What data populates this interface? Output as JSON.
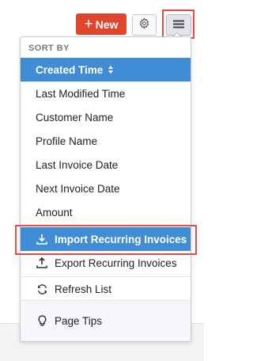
{
  "toolbar": {
    "new_button": {
      "label": "New",
      "icon": "plus-icon"
    },
    "settings_button": {
      "icon": "gear-icon"
    },
    "menu_button": {
      "icon": "hamburger-menu-icon"
    }
  },
  "dropdown": {
    "sort_section_label": "SORT BY",
    "sort_options": [
      {
        "label": "Created Time",
        "selected": true,
        "icon": "sort-arrows-icon"
      },
      {
        "label": "Last Modified Time",
        "selected": false
      },
      {
        "label": "Customer Name",
        "selected": false
      },
      {
        "label": "Profile Name",
        "selected": false
      },
      {
        "label": "Last Invoice Date",
        "selected": false
      },
      {
        "label": "Next Invoice Date",
        "selected": false
      },
      {
        "label": "Amount",
        "selected": false
      }
    ],
    "actions": [
      {
        "label": "Import Recurring Invoices",
        "icon": "import-icon",
        "active": true
      },
      {
        "label": "Export Recurring Invoices",
        "icon": "export-icon",
        "active": false
      },
      {
        "label": "Refresh List",
        "icon": "refresh-icon",
        "active": false
      }
    ],
    "footer": {
      "label": "Page Tips",
      "icon": "lightbulb-icon"
    }
  },
  "colors": {
    "new_button": "#e0452d",
    "selected_item": "#408dd5",
    "highlight_box": "#e04e47"
  }
}
